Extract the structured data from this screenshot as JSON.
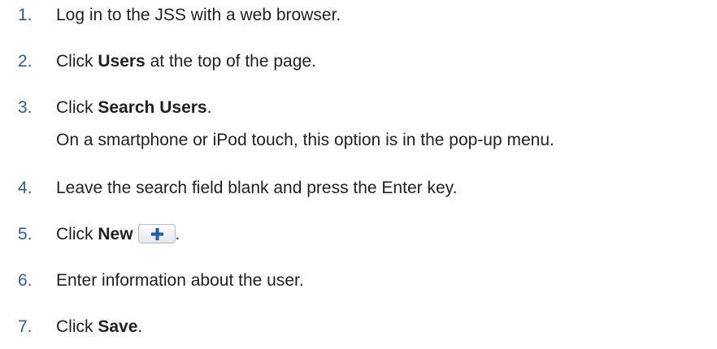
{
  "steps": [
    {
      "num": "1.",
      "text": "Log in to the JSS with a web browser."
    },
    {
      "num": "2.",
      "pre": "Click ",
      "bold": "Users",
      "post": " at the top of the page."
    },
    {
      "num": "3.",
      "pre": "Click ",
      "bold": "Search Users",
      "post": ".",
      "note": "On a smartphone or iPod touch, this option is in the pop-up menu."
    },
    {
      "num": "4.",
      "text": "Leave the search field blank and press the Enter key."
    },
    {
      "num": "5.",
      "pre": "Click ",
      "bold": "New",
      "post": "."
    },
    {
      "num": "6.",
      "text": "Enter information about the user."
    },
    {
      "num": "7.",
      "pre": "Click ",
      "bold": "Save",
      "post": "."
    }
  ],
  "colors": {
    "step_number": "#2e5b9e",
    "body_text": "#231f20",
    "plus_icon": "#2a5aa6"
  },
  "icons": {
    "new_button": "plus-icon"
  }
}
